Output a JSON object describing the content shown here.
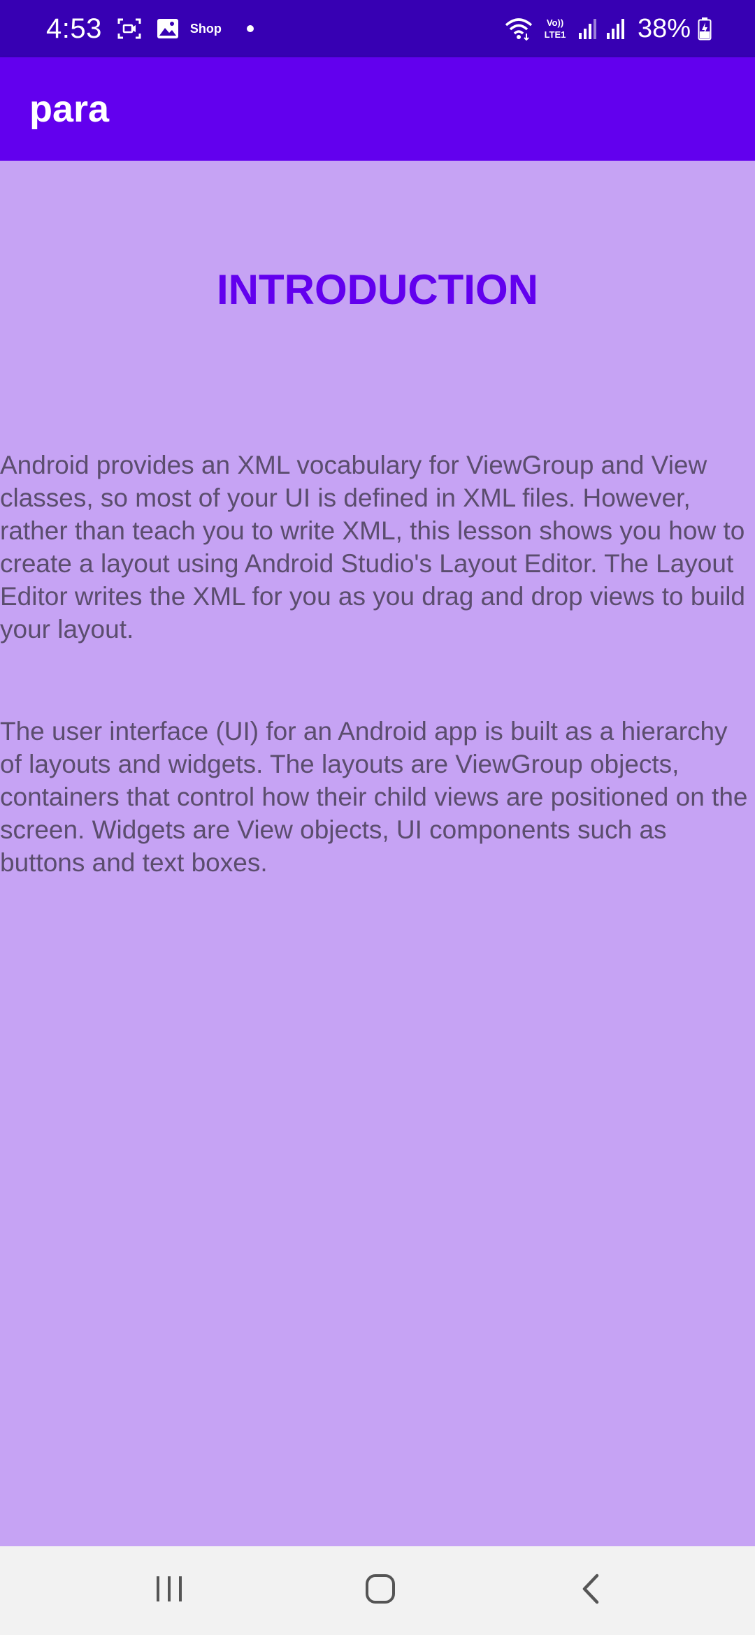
{
  "status_bar": {
    "time": "4:53",
    "notification_label": "Shop",
    "network_label": "Vo)) LTE1",
    "battery_percent": "38%",
    "icons": [
      "screen-record-icon",
      "gallery-icon",
      "dot-icon",
      "wifi-icon",
      "signal-icon",
      "signal-icon",
      "battery-charging-icon"
    ]
  },
  "app_bar": {
    "title": "para"
  },
  "main": {
    "heading": "INTRODUCTION",
    "paragraphs": [
      "Android provides an XML vocabulary for ViewGroup and View classes, so most of your UI is defined in XML files. However, rather than teach you to write XML, this lesson shows you how to create a layout using Android Studio's Layout Editor. The Layout Editor writes the XML for you as you drag and drop views to build your layout.",
      "The user interface (UI) for an Android app is built as a hierarchy of layouts and widgets. The layouts are ViewGroup objects, containers that control how their child views are positioned on the screen. Widgets are View objects, UI components such as buttons and text boxes."
    ]
  },
  "nav_bar": {
    "icons": [
      "recents-icon",
      "home-icon",
      "back-icon"
    ]
  },
  "colors": {
    "status_bar": "#3700B3",
    "app_bar": "#6200EE",
    "background": "#C6A3F4",
    "heading": "#6200EE",
    "body_text": "#5B4D6E",
    "nav_bar": "#F2F2F2"
  }
}
